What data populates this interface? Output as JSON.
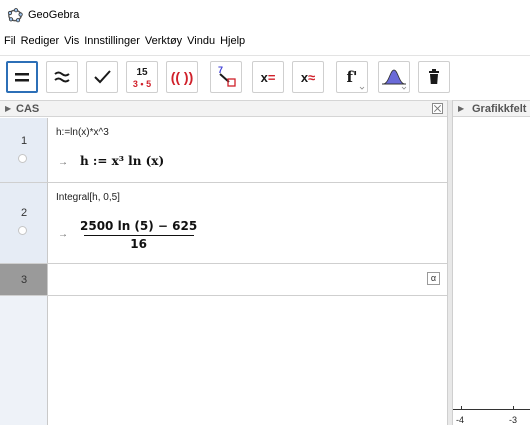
{
  "app": {
    "title": "GeoGebra",
    "icon": "geogebra-icon"
  },
  "menu": [
    "Fil",
    "Rediger",
    "Vis",
    "Innstillinger",
    "Verktøy",
    "Vindu",
    "Hjelp"
  ],
  "toolbar": {
    "tools": [
      {
        "name": "evaluate-tool",
        "icon": "equals-icon",
        "selected": true
      },
      {
        "name": "numeric-tool",
        "icon": "approx-icon"
      },
      {
        "name": "keep-input-tool",
        "icon": "checkmark-icon"
      },
      {
        "name": "factor-tool",
        "icon": "factor-icon",
        "glyph_top": "15",
        "glyph_bottom": "3 • 5"
      },
      {
        "name": "expand-tool",
        "icon": "parentheses-icon",
        "glyph": "(( ))"
      },
      {
        "name": "substitute-tool",
        "icon": "substitute-icon",
        "glyph": "7"
      },
      {
        "name": "solve-tool",
        "icon": "solve-icon",
        "glyph": "x="
      },
      {
        "name": "solve-numerically-tool",
        "icon": "solve-numerically-icon",
        "glyph": "x≈"
      },
      {
        "name": "derivative-tool",
        "icon": "derivative-icon",
        "glyph": "f'"
      },
      {
        "name": "probability-tool",
        "icon": "normal-distribution-icon"
      },
      {
        "name": "delete-tool",
        "icon": "trash-icon"
      }
    ]
  },
  "cas": {
    "title": "CAS",
    "rows": [
      {
        "number": "1",
        "input": "h:=ln(x)*x^3",
        "arrow": "→",
        "output": "h := x³ ln (x)"
      },
      {
        "number": "2",
        "input": "Integral[h, 0,5]",
        "arrow": "→",
        "output_numerator": "2500 ln (5) − 625",
        "output_denominator": "16"
      },
      {
        "number": "3",
        "input": "",
        "alpha_button": "α"
      }
    ]
  },
  "graphics": {
    "title": "Grafikkfelt",
    "x_ticks": [
      "-4",
      "-3"
    ]
  }
}
